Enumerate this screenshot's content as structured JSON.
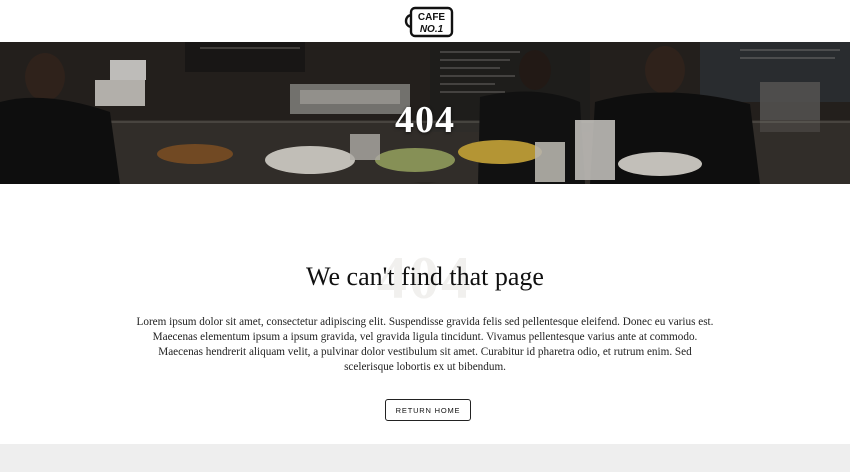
{
  "header": {
    "logo_line1": "CAFE",
    "logo_line2": "NO.1"
  },
  "hero": {
    "title": "404"
  },
  "main": {
    "ghost_text": "404",
    "heading": "We can't find that page",
    "body": "Lorem ipsum dolor sit amet, consectetur adipiscing elit. Suspendisse gravida felis sed pellentesque eleifend. Donec eu varius est. Maecenas elementum ipsum a ipsum gravida, vel gravida ligula tincidunt. Vivamus pellentesque varius ante at commodo. Maecenas hendrerit aliquam velit, a pulvinar dolor vestibulum sit amet. Curabitur id pharetra odio, et rutrum enim. Sed scelerisque lobortis ex ut bibendum.",
    "button_label": "RETURN HOME"
  },
  "colors": {
    "background": "#ffffff",
    "text": "#111111",
    "footer_band": "#eeeeee",
    "hero_overlay": "#2a2622"
  },
  "icons": {
    "logo": "coffee-cup-logo-icon"
  }
}
